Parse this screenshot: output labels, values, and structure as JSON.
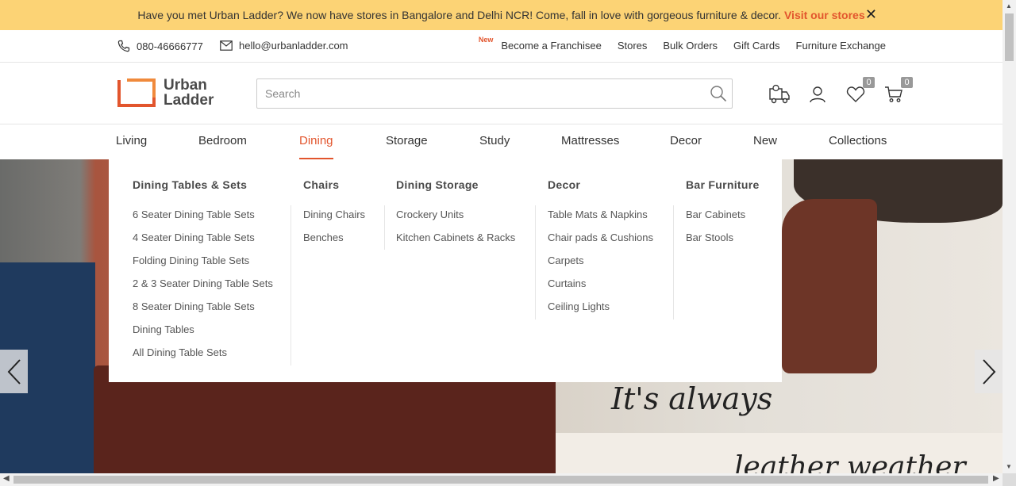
{
  "announcement": {
    "text": "Have you met Urban Ladder? We now have stores in Bangalore and Delhi NCR! Come, fall in love with gorgeous furniture & decor.",
    "link": "Visit our stores",
    "close": "✕"
  },
  "topbar": {
    "phone": "080-46666777",
    "email": "hello@urbanladder.com",
    "new_tag": "New",
    "links": [
      "Become a Franchisee",
      "Stores",
      "Bulk Orders",
      "Gift Cards",
      "Furniture Exchange"
    ]
  },
  "logo": {
    "line1": "Urban",
    "line2": "Ladder"
  },
  "search": {
    "placeholder": "Search",
    "value": ""
  },
  "header_icons": {
    "wishlist_count": "0",
    "cart_count": "0"
  },
  "nav": {
    "items": [
      "Living",
      "Bedroom",
      "Dining",
      "Storage",
      "Study",
      "Mattresses",
      "Decor",
      "New",
      "Collections"
    ],
    "active": "Dining"
  },
  "mega_menu": {
    "columns": [
      {
        "title": "Dining Tables & Sets",
        "items": [
          "6 Seater Dining Table Sets",
          "4 Seater Dining Table Sets",
          "Folding Dining Table Sets",
          "2 & 3 Seater Dining Table Sets",
          "8 Seater Dining Table Sets",
          "Dining Tables",
          "All Dining Table Sets"
        ]
      },
      {
        "title": "Chairs",
        "items": [
          "Dining Chairs",
          "Benches"
        ]
      },
      {
        "title": "Dining Storage",
        "items": [
          "Crockery Units",
          "Kitchen Cabinets & Racks"
        ]
      },
      {
        "title": "Decor",
        "items": [
          "Table Mats & Napkins",
          "Chair pads & Cushions",
          "Carpets",
          "Curtains",
          "Ceiling Lights"
        ]
      },
      {
        "title": "Bar Furniture",
        "items": [
          "Bar Cabinets",
          "Bar Stools"
        ]
      }
    ]
  },
  "hero": {
    "text1": "It's always",
    "text2": "leather weather"
  },
  "colors": {
    "accent": "#e2552d",
    "banner": "#fcd375"
  }
}
